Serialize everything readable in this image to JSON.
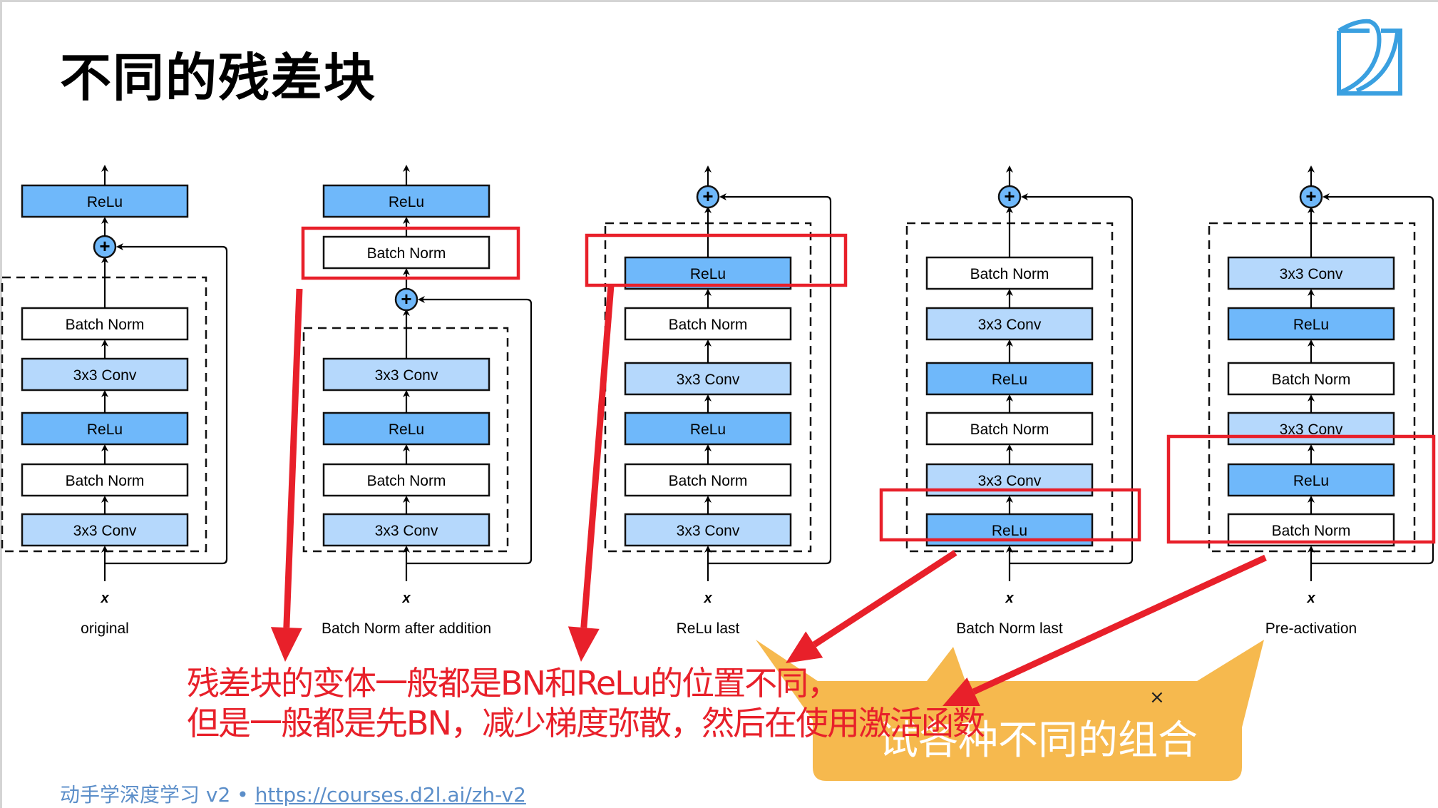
{
  "slide": {
    "title": "不同的残差块",
    "footer": {
      "course": "动手学深度学习 v2 • ",
      "link": "https://courses.d2l.ai/zh-v2"
    },
    "logo_icon": "d2l-book-icon"
  },
  "colors": {
    "relu": "#6fb8fa",
    "conv": "#b5d8fc",
    "batchnorm": "#ffffff",
    "add_node": "#6fb8fa",
    "highlight": "#e8202a",
    "callout": "#f6b94e",
    "footer_text": "#5b8ec9"
  },
  "diagram": {
    "input_label": "x",
    "add_symbol": "+",
    "variants": [
      {
        "caption": "original",
        "outside_top": [
          "ReLu"
        ],
        "add_position": "between-block-and-relu",
        "block": [
          "Batch Norm",
          "3x3 Conv",
          "ReLu",
          "Batch Norm",
          "3x3 Conv"
        ],
        "highlighted": []
      },
      {
        "caption": "Batch Norm after addition",
        "outside_top": [
          "ReLu",
          "Batch Norm"
        ],
        "add_position": "below-batch-norm",
        "block": [
          "3x3 Conv",
          "ReLu",
          "Batch Norm",
          "3x3 Conv"
        ],
        "highlighted": [
          "Batch Norm (after addition)"
        ]
      },
      {
        "caption": "ReLu last",
        "outside_top": [],
        "add_position": "top",
        "block": [
          "ReLu",
          "Batch Norm",
          "3x3 Conv",
          "ReLu",
          "Batch Norm",
          "3x3 Conv"
        ],
        "highlighted": [
          "ReLu (top of block)"
        ]
      },
      {
        "caption": "Batch Norm last",
        "outside_top": [],
        "add_position": "top",
        "block": [
          "Batch Norm",
          "3x3 Conv",
          "ReLu",
          "Batch Norm",
          "3x3 Conv",
          "ReLu"
        ],
        "highlighted": [
          "ReLu (bottom of block)"
        ]
      },
      {
        "caption": "Pre-activation",
        "outside_top": [],
        "add_position": "top",
        "block": [
          "3x3 Conv",
          "ReLu",
          "Batch Norm",
          "3x3 Conv",
          "ReLu",
          "Batch Norm"
        ],
        "highlighted": [
          "ReLu + Batch Norm (bottom of block)"
        ]
      }
    ]
  },
  "annotations": {
    "note_line1": "残差块的变体一般都是BN和ReLu的位置不同，",
    "note_line2": "但是一般都是先BN，减少梯度弥散，然后在使用激活函数",
    "callout_text": "试各种不同的组合",
    "callout_close": "×"
  }
}
